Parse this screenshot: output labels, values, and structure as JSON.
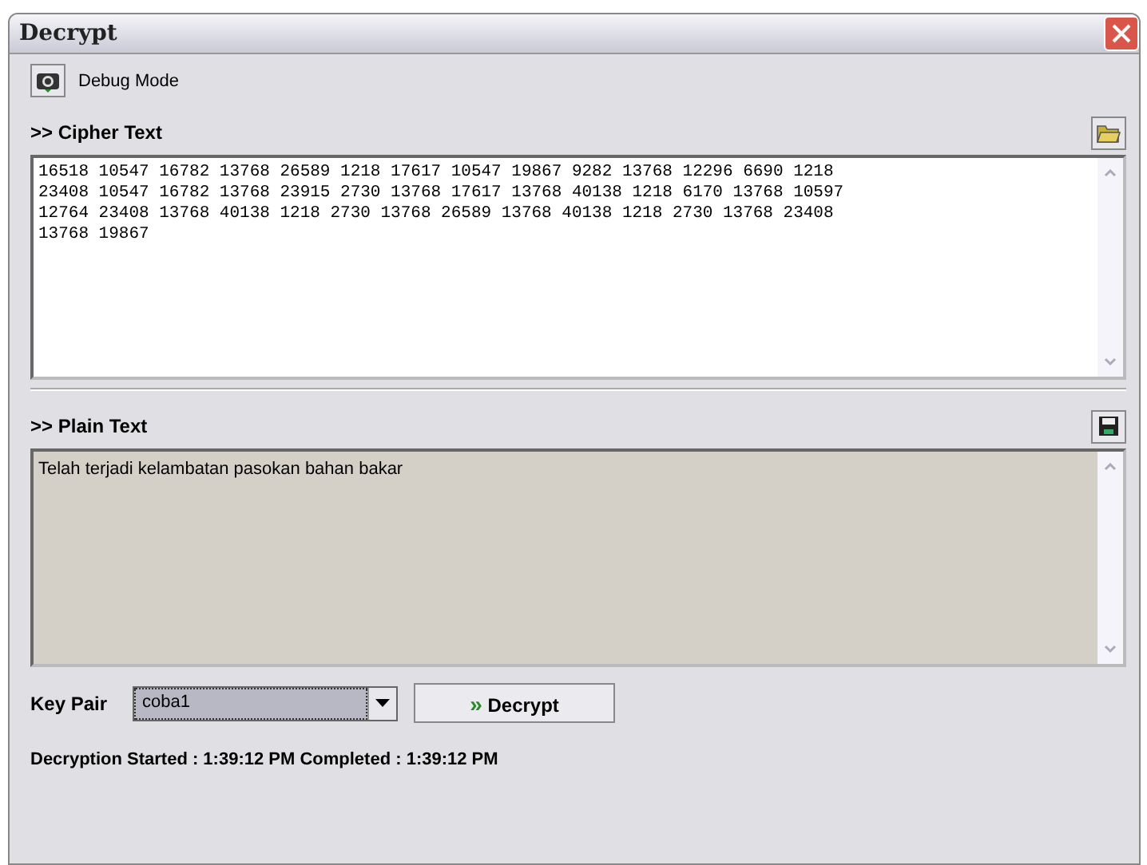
{
  "window": {
    "title": "Decrypt"
  },
  "debug_button": {
    "label": "Debug Mode"
  },
  "cipher": {
    "label": ">> Cipher Text",
    "text": "16518 10547 16782 13768 26589 1218 17617 10547 19867 9282 13768 12296 6690 1218\n23408 10547 16782 13768 23915 2730 13768 17617 13768 40138 1218 6170 13768 10597\n12764 23408 13768 40138 1218 2730 13768 26589 13768 40138 1218 2730 13768 23408\n13768 19867"
  },
  "plain": {
    "label": ">> Plain Text",
    "text": "Telah terjadi kelambatan pasokan bahan bakar"
  },
  "key_pair": {
    "label": "Key Pair",
    "value": "coba1"
  },
  "decrypt_button": {
    "icon": "»",
    "label": "Decrypt"
  },
  "status": "Decryption Started : 1:39:12 PM Completed : 1:39:12 PM"
}
